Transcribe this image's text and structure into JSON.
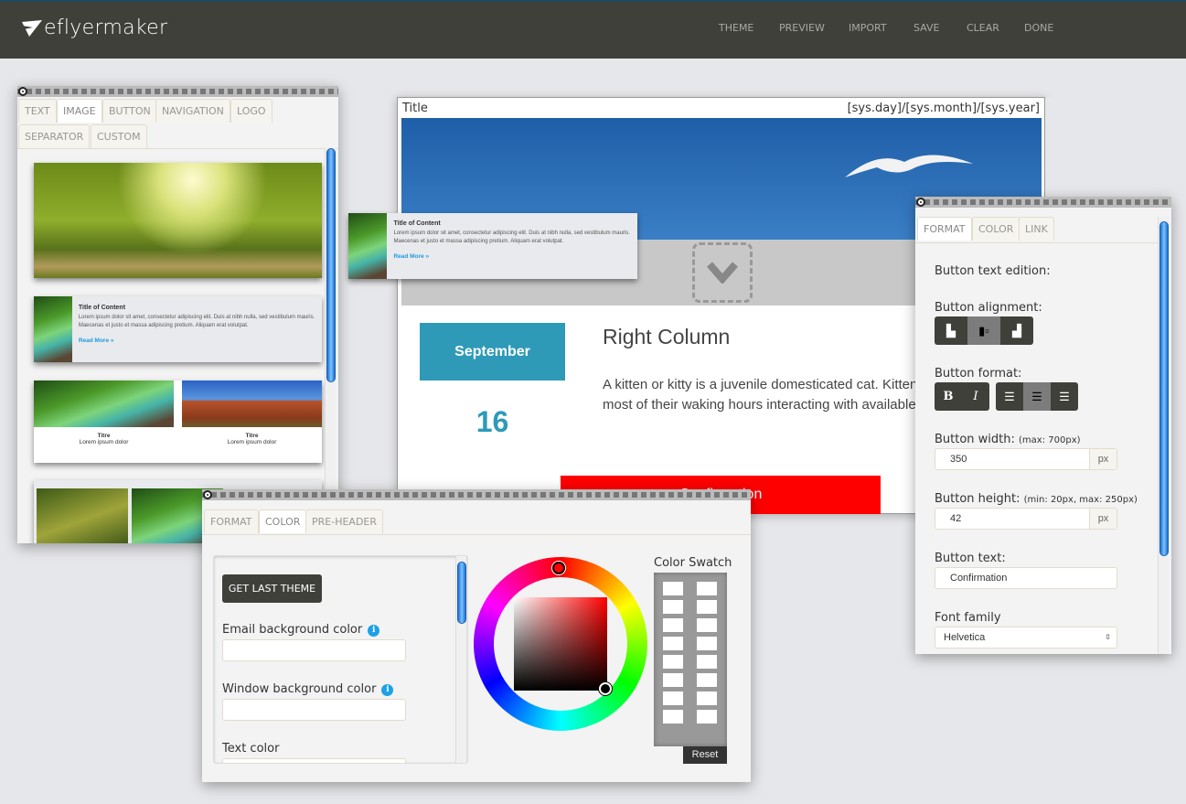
{
  "app": {
    "logo": "eflyermaker",
    "nav": [
      "THEME",
      "PREVIEW",
      "IMPORT",
      "SAVE",
      "CLEAR",
      "DONE"
    ]
  },
  "blocks_panel": {
    "tabs": [
      "TEXT",
      "IMAGE",
      "BUTTON",
      "NAVIGATION",
      "LOGO",
      "SEPARATOR",
      "CUSTOM"
    ],
    "active_tab": "IMAGE",
    "card": {
      "title": "Title of Content",
      "text": "Lorem ipsum dolor sit amet, consectetur adipiscing elit. Duis at nibh nulla, sed vestibulum mauris. Maecenas et justo et massa adipiscing pretium. Aliquam erat volutpat.",
      "link": "Read More »"
    },
    "two_col": [
      {
        "title": "Titre",
        "text": "Lorem ipsum dolor"
      },
      {
        "title": "Titre",
        "text": "Lorem ipsum dolor"
      }
    ]
  },
  "email": {
    "title": "Title",
    "date": "[sys.day]/[sys.month]/[sys.year]",
    "month": "September",
    "day": "16",
    "heading": "Right Column",
    "body": "A kitten or kitty is a juvenile domesticated cat. Kittens are social animals and spend most of their waking hours interacting with available companions.",
    "button_text": "Confirmation",
    "button_color": "#ff0000",
    "accent": "#2e9ab8"
  },
  "format_panel": {
    "tabs": [
      "FORMAT",
      "COLOR",
      "LINK"
    ],
    "active_tab": "FORMAT",
    "text_edition": "Button text edition:",
    "alignment_label": "Button alignment:",
    "format_label": "Button format:",
    "width_label": "Button width:",
    "width_hint": "(max: 700px)",
    "width_value": "350",
    "unit": "px",
    "height_label": "Button height:",
    "height_hint": "(min: 20px, max: 250px)",
    "height_value": "42",
    "text_label": "Button text:",
    "text_value": "Confirmation",
    "font_label": "Font family",
    "font_value": "Helvetica",
    "alignment_selected": "center",
    "text_align_selected": "center"
  },
  "color_panel": {
    "tabs": [
      "FORMAT",
      "COLOR",
      "PRE-HEADER"
    ],
    "active_tab": "COLOR",
    "get_last_theme": "GET LAST THEME",
    "fields": [
      "Email background color",
      "Window background color",
      "Text color"
    ],
    "swatch_title": "Color Swatch",
    "reset": "Reset",
    "hue": "#ff0000"
  }
}
